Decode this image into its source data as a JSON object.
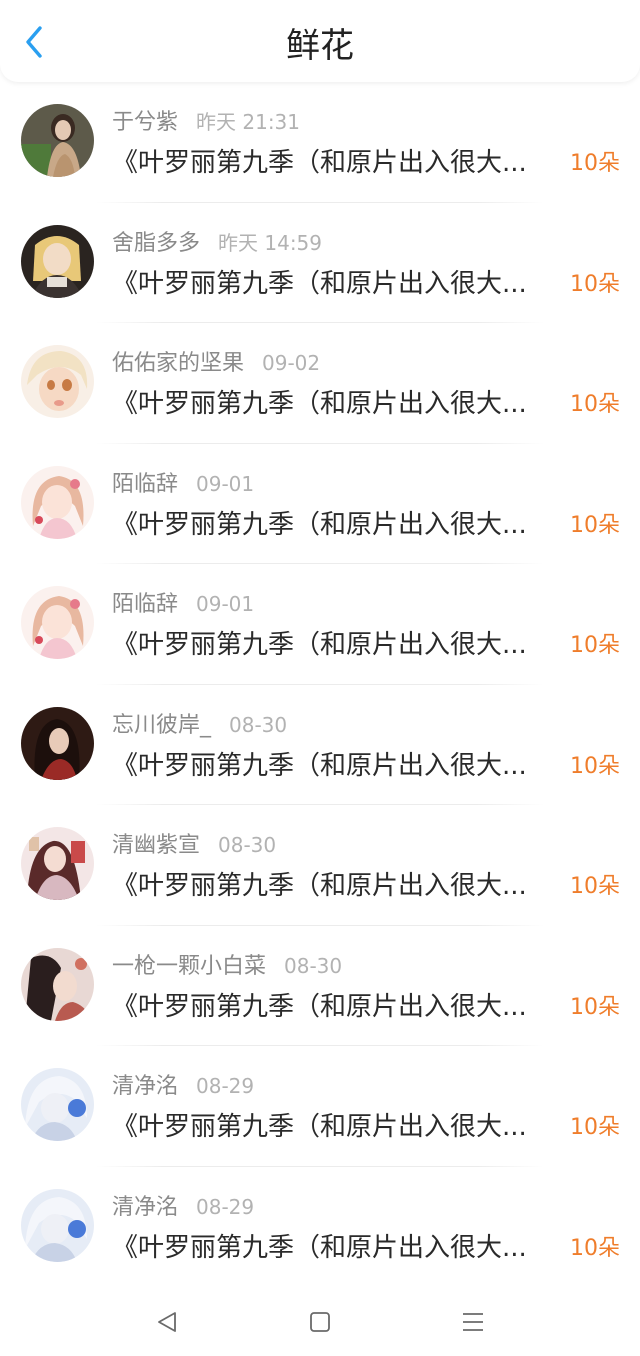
{
  "header": {
    "title": "鲜花",
    "back_icon": "chevron-left-icon",
    "accent_color": "#2a9ff0"
  },
  "colors": {
    "amount": "#ef7d2b",
    "name": "#8a8a8a",
    "time": "#b2b2b2",
    "content": "#2a2a2a"
  },
  "items": [
    {
      "name": "于兮紫",
      "time": "昨天 21:31",
      "content": "《叶罗丽第九季（和原片出入很大...",
      "amount": "10朵"
    },
    {
      "name": "舍脂多多",
      "time": "昨天 14:59",
      "content": "《叶罗丽第九季（和原片出入很大...",
      "amount": "10朵"
    },
    {
      "name": "佑佑家的坚果",
      "time": "09-02",
      "content": "《叶罗丽第九季（和原片出入很大...",
      "amount": "10朵"
    },
    {
      "name": "陌临辞",
      "time": "09-01",
      "content": "《叶罗丽第九季（和原片出入很大...",
      "amount": "10朵"
    },
    {
      "name": "陌临辞",
      "time": "09-01",
      "content": "《叶罗丽第九季（和原片出入很大...",
      "amount": "10朵"
    },
    {
      "name": "忘川彼岸_",
      "time": "08-30",
      "content": "《叶罗丽第九季（和原片出入很大...",
      "amount": "10朵"
    },
    {
      "name": "清幽紫宣",
      "time": "08-30",
      "content": "《叶罗丽第九季（和原片出入很大...",
      "amount": "10朵"
    },
    {
      "name": "一枪一颗小白菜",
      "time": "08-30",
      "content": "《叶罗丽第九季（和原片出入很大...",
      "amount": "10朵"
    },
    {
      "name": "清净洺",
      "time": "08-29",
      "content": "《叶罗丽第九季（和原片出入很大...",
      "amount": "10朵"
    },
    {
      "name": "清净洺",
      "time": "08-29",
      "content": "《叶罗丽第九季（和原片出入很大...",
      "amount": "10朵"
    }
  ],
  "navbar": {
    "back_icon": "triangle-back-icon",
    "home_icon": "square-home-icon",
    "menu_icon": "three-lines-menu-icon"
  }
}
